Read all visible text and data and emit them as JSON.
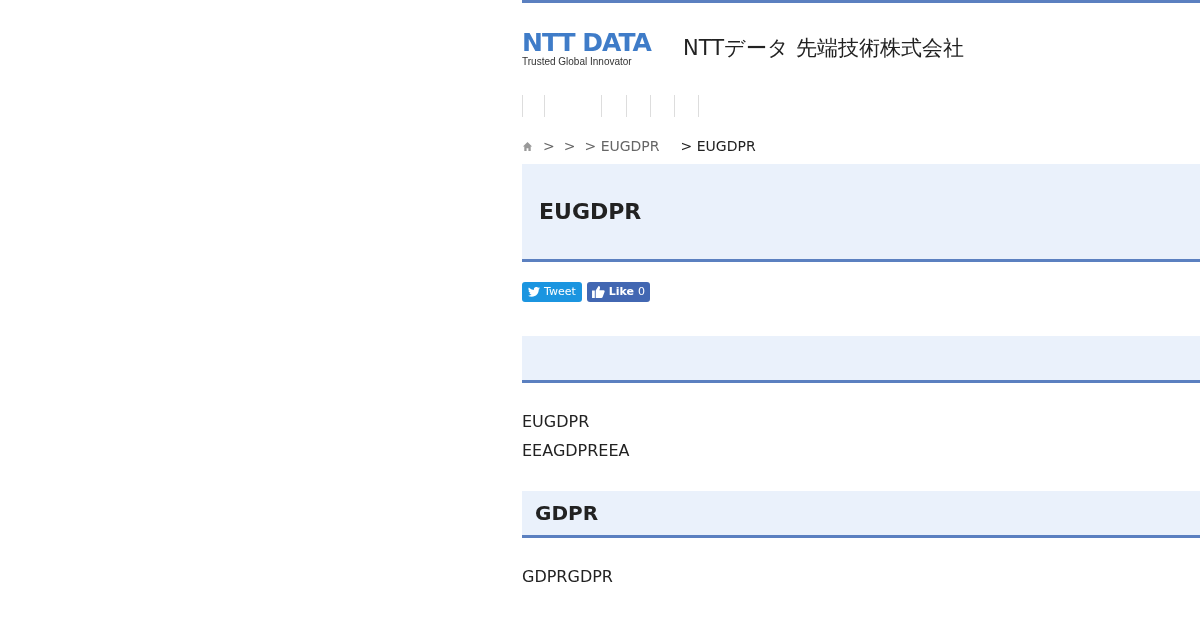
{
  "logo": {
    "wordmark": "NTT DATA",
    "tagline": "Trusted Global Innovator"
  },
  "company_name": "NTTデータ 先端技術株式会社",
  "breadcrumb": [
    {
      "text": ">",
      "kind": "link"
    },
    {
      "text": ">",
      "kind": "link"
    },
    {
      "text": "> EUGDPR",
      "kind": "link"
    },
    {
      "text": "> EUGDPR",
      "kind": "current"
    }
  ],
  "page_title": "EUGDPR",
  "share": {
    "tweet": "Tweet",
    "like": "Like",
    "like_count": "0"
  },
  "sections": [
    {
      "paragraphs": [
        "EUGDPR",
        "EEAGDPREEA"
      ]
    },
    {
      "heading": "GDPR",
      "paragraphs": [
        "GDPRGDPR"
      ]
    }
  ]
}
